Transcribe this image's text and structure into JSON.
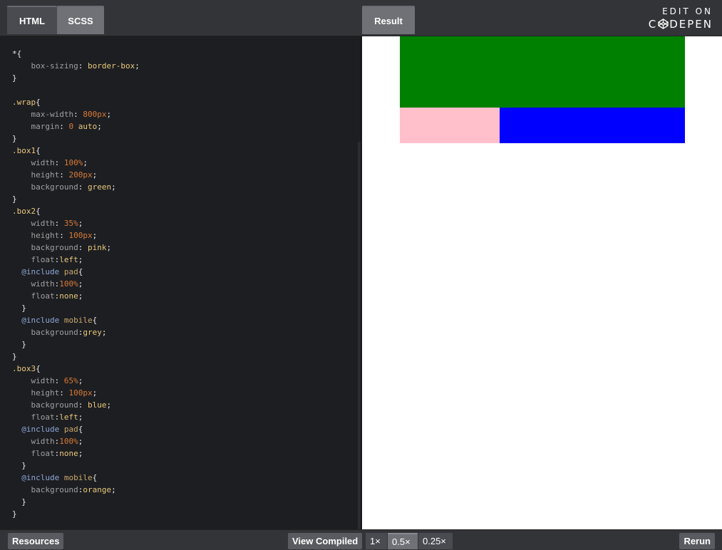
{
  "header": {
    "tabs": [
      {
        "label": "HTML"
      },
      {
        "label": "SCSS"
      }
    ],
    "result_tab": "Result",
    "brand_line1": "EDIT ON",
    "brand_line2_left": "C",
    "brand_line2_right": "DEPEN"
  },
  "editor": {
    "lines": [
      [
        [
          "punc",
          "*{"
        ]
      ],
      [
        [
          "prop",
          "    box-sizing"
        ],
        [
          "punc",
          ": "
        ],
        [
          "val",
          "border-box"
        ],
        [
          "punc",
          ";"
        ]
      ],
      [
        [
          "punc",
          "}"
        ]
      ],
      [],
      [
        [
          "sel",
          ".wrap"
        ],
        [
          "punc",
          "{"
        ]
      ],
      [
        [
          "prop",
          "    max-width"
        ],
        [
          "punc",
          ": "
        ],
        [
          "num",
          "800px"
        ],
        [
          "punc",
          ";"
        ]
      ],
      [
        [
          "prop",
          "    margin"
        ],
        [
          "punc",
          ": "
        ],
        [
          "num",
          "0"
        ],
        [
          "punc",
          " "
        ],
        [
          "val",
          "auto"
        ],
        [
          "punc",
          ";"
        ]
      ],
      [
        [
          "punc",
          "}"
        ]
      ],
      [
        [
          "sel",
          ".box1"
        ],
        [
          "punc",
          "{"
        ]
      ],
      [
        [
          "prop",
          "    width"
        ],
        [
          "punc",
          ": "
        ],
        [
          "num",
          "100%"
        ],
        [
          "punc",
          ";"
        ]
      ],
      [
        [
          "prop",
          "    height"
        ],
        [
          "punc",
          ": "
        ],
        [
          "num",
          "200px"
        ],
        [
          "punc",
          ";"
        ]
      ],
      [
        [
          "prop",
          "    background"
        ],
        [
          "punc",
          ": "
        ],
        [
          "val",
          "green"
        ],
        [
          "punc",
          ";"
        ]
      ],
      [
        [
          "punc",
          "}"
        ]
      ],
      [
        [
          "sel",
          ".box2"
        ],
        [
          "punc",
          "{"
        ]
      ],
      [
        [
          "prop",
          "    width"
        ],
        [
          "punc",
          ": "
        ],
        [
          "num",
          "35%"
        ],
        [
          "punc",
          ";"
        ]
      ],
      [
        [
          "prop",
          "    height"
        ],
        [
          "punc",
          ": "
        ],
        [
          "num",
          "100px"
        ],
        [
          "punc",
          ";"
        ]
      ],
      [
        [
          "prop",
          "    background"
        ],
        [
          "punc",
          ": "
        ],
        [
          "val",
          "pink"
        ],
        [
          "punc",
          ";"
        ]
      ],
      [
        [
          "prop",
          "    float"
        ],
        [
          "punc",
          ":"
        ],
        [
          "val",
          "left"
        ],
        [
          "punc",
          ";"
        ]
      ],
      [
        [
          "at",
          "  @include"
        ],
        [
          "punc",
          " "
        ],
        [
          "mix",
          "pad"
        ],
        [
          "punc",
          "{"
        ]
      ],
      [
        [
          "prop",
          "    width"
        ],
        [
          "punc",
          ":"
        ],
        [
          "num",
          "100%"
        ],
        [
          "punc",
          ";"
        ]
      ],
      [
        [
          "prop",
          "    float"
        ],
        [
          "punc",
          ":"
        ],
        [
          "val",
          "none"
        ],
        [
          "punc",
          ";"
        ]
      ],
      [
        [
          "punc",
          "  }"
        ]
      ],
      [
        [
          "at",
          "  @include"
        ],
        [
          "punc",
          " "
        ],
        [
          "mix",
          "mobile"
        ],
        [
          "punc",
          "{"
        ]
      ],
      [
        [
          "prop",
          "    background"
        ],
        [
          "punc",
          ":"
        ],
        [
          "val",
          "grey"
        ],
        [
          "punc",
          ";"
        ]
      ],
      [
        [
          "punc",
          "  }"
        ]
      ],
      [
        [
          "punc",
          "}"
        ]
      ],
      [
        [
          "sel",
          ".box3"
        ],
        [
          "punc",
          "{"
        ]
      ],
      [
        [
          "prop",
          "    width"
        ],
        [
          "punc",
          ": "
        ],
        [
          "num",
          "65%"
        ],
        [
          "punc",
          ";"
        ]
      ],
      [
        [
          "prop",
          "    height"
        ],
        [
          "punc",
          ": "
        ],
        [
          "num",
          "100px"
        ],
        [
          "punc",
          ";"
        ]
      ],
      [
        [
          "prop",
          "    background"
        ],
        [
          "punc",
          ": "
        ],
        [
          "val",
          "blue"
        ],
        [
          "punc",
          ";"
        ]
      ],
      [
        [
          "prop",
          "    float"
        ],
        [
          "punc",
          ":"
        ],
        [
          "val",
          "left"
        ],
        [
          "punc",
          ";"
        ]
      ],
      [
        [
          "at",
          "  @include"
        ],
        [
          "punc",
          " "
        ],
        [
          "mix",
          "pad"
        ],
        [
          "punc",
          "{"
        ]
      ],
      [
        [
          "prop",
          "    width"
        ],
        [
          "punc",
          ":"
        ],
        [
          "num",
          "100%"
        ],
        [
          "punc",
          ";"
        ]
      ],
      [
        [
          "prop",
          "    float"
        ],
        [
          "punc",
          ":"
        ],
        [
          "val",
          "none"
        ],
        [
          "punc",
          ";"
        ]
      ],
      [
        [
          "punc",
          "  }"
        ]
      ],
      [
        [
          "at",
          "  @include"
        ],
        [
          "punc",
          " "
        ],
        [
          "mix",
          "mobile"
        ],
        [
          "punc",
          "{"
        ]
      ],
      [
        [
          "prop",
          "    background"
        ],
        [
          "punc",
          ":"
        ],
        [
          "val",
          "orange"
        ],
        [
          "punc",
          ";"
        ]
      ],
      [
        [
          "punc",
          "  }"
        ]
      ],
      [
        [
          "punc",
          "}"
        ]
      ]
    ]
  },
  "result": {
    "boxes": [
      {
        "name": "box1",
        "color": "green"
      },
      {
        "name": "box2",
        "color": "pink"
      },
      {
        "name": "box3",
        "color": "blue"
      }
    ]
  },
  "footer": {
    "resources_label": "Resources",
    "view_compiled_label": "View Compiled",
    "zoom_options": [
      "1×",
      "0.5×",
      "0.25×"
    ],
    "selected_zoom": "0.5×",
    "rerun_label": "Rerun"
  }
}
